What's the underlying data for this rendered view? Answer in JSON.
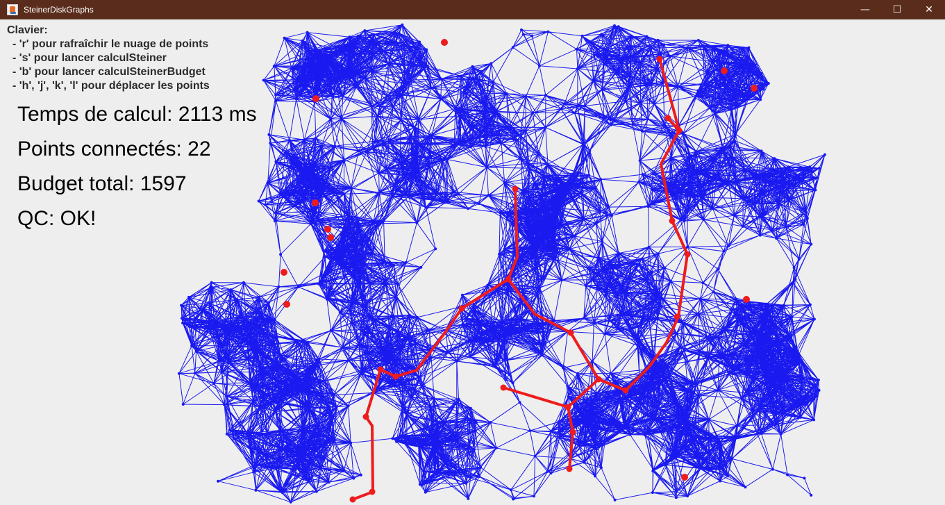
{
  "window": {
    "title": "SteinerDiskGraphs",
    "minimize_glyph": "—",
    "maximize_glyph": "☐",
    "close_glyph": "✕",
    "app_icon": "java-coffee-icon"
  },
  "help": {
    "heading": "Clavier:",
    "lines": [
      "- 'r' pour rafraîchir le nuage de points",
      "- 's' pour lancer calculSteiner",
      "- 'b' pour lancer calculSteinerBudget",
      "- 'h', 'j', 'k', 'l' pour déplacer les points"
    ]
  },
  "stats": {
    "time": "Temps de calcul: 2113 ms",
    "connected": "Points connectés: 22",
    "budget": "Budget total: 1597",
    "qc": "QC: OK!"
  },
  "colors": {
    "background": "#eeeeee",
    "titlebar": "#5a2c1c",
    "graph_edges": "#1a1af0",
    "steiner_tree": "#ee1c1c",
    "hit_points": "#ee1c1c"
  }
}
